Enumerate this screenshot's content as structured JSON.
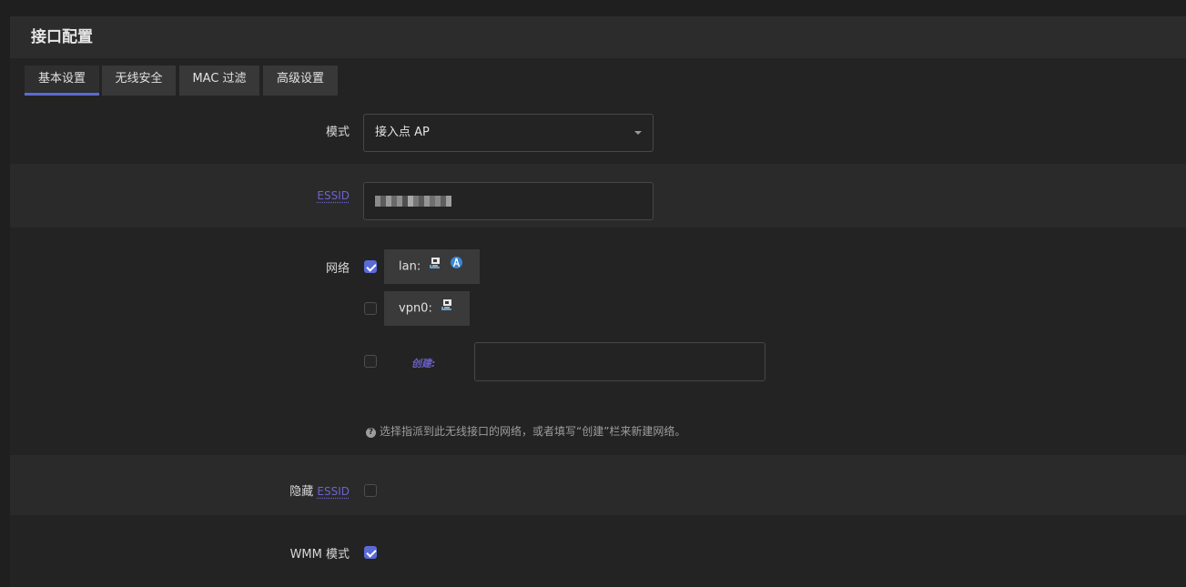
{
  "panel": {
    "title": "接口配置"
  },
  "tabs": [
    {
      "label": "基本设置",
      "active": true
    },
    {
      "label": "无线安全",
      "active": false
    },
    {
      "label": "MAC 过滤",
      "active": false
    },
    {
      "label": "高级设置",
      "active": false
    }
  ],
  "mode": {
    "label": "模式",
    "value": "接入点 AP"
  },
  "essid": {
    "label": "ESSID",
    "value": ""
  },
  "network": {
    "label": "网络",
    "options": [
      {
        "name": "lan:",
        "checked": true,
        "icons": [
          "ethernet-port-icon",
          "wireless-antenna-icon"
        ]
      },
      {
        "name": "vpn0:",
        "checked": false,
        "icons": [
          "ethernet-port-icon"
        ]
      }
    ],
    "create_label": "创建:",
    "create_checked": false,
    "help": "选择指派到此无线接口的网络，或者填写“创建”栏来新建网络。"
  },
  "hidden_essid": {
    "label_prefix": "隐藏",
    "label_abbr": "ESSID",
    "checked": false
  },
  "wmm": {
    "label": "WMM 模式",
    "checked": true
  },
  "colors": {
    "accent": "#5a6bd6",
    "abbr": "#6d63cc"
  }
}
